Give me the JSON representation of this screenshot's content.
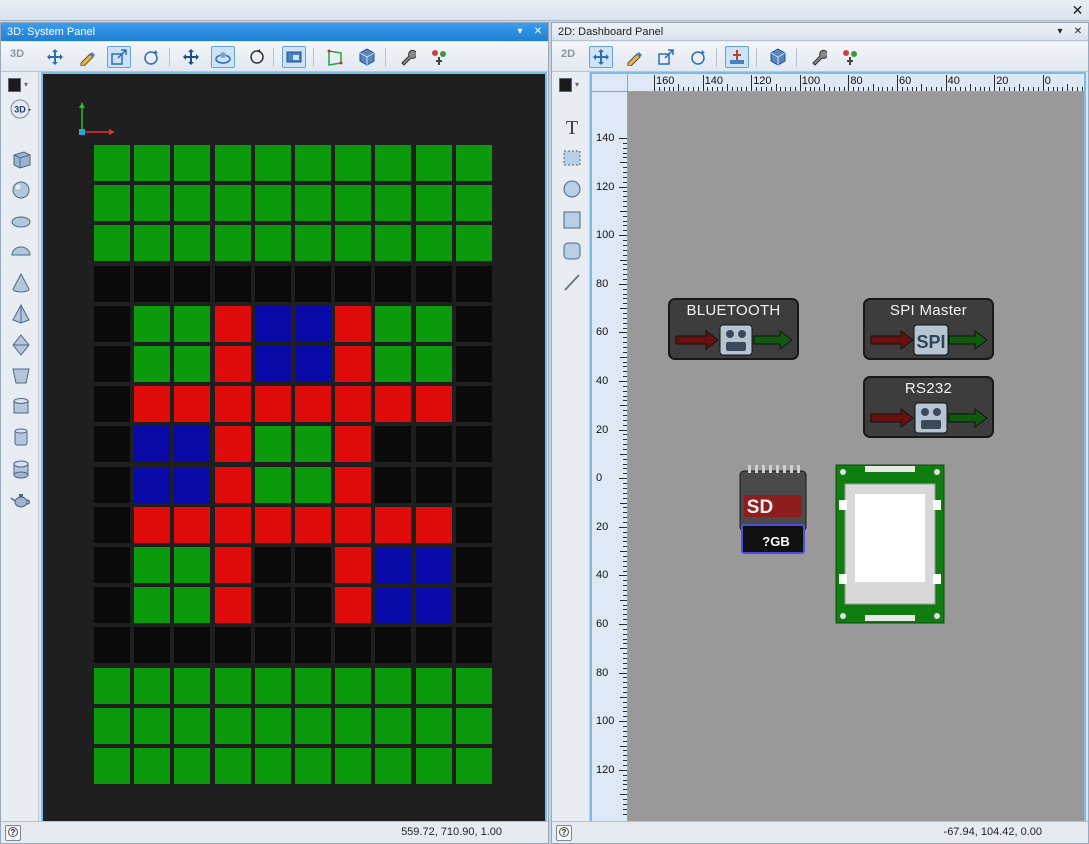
{
  "window": {
    "close_glyph": "✕"
  },
  "panel3d": {
    "title": "3D: System Panel",
    "mode_label": "3D",
    "dropdown_glyph": "▾",
    "close_glyph": "✕",
    "mode_button_label": "3D",
    "status_coords": "559.72, 710.90, 1.00",
    "toolbar_icons": [
      "move-icon",
      "pencil-icon",
      "scale-icon",
      "rotate-icon",
      "pan-icon",
      "orbit-icon",
      "rotate-view-icon",
      "view-2d-icon",
      "perspective-icon",
      "cube-view-icon",
      "wrench-icon",
      "components-icon"
    ],
    "active_tools": [
      "scale-icon",
      "orbit-icon",
      "view-2d-icon"
    ],
    "side_shapes": [
      "box-icon",
      "sphere-icon",
      "ellipsoid-icon",
      "hemisphere-icon",
      "cone-icon",
      "pyramid-icon",
      "octahedron-icon",
      "prism-icon",
      "cylinder-icon",
      "tube-icon",
      "drum-icon",
      "teapot-icon"
    ],
    "grid_colors": {
      "G": "#0b9a0b",
      "R": "#e00c0c",
      "B": "#0a0aa8",
      "K": "#0a0a0a"
    },
    "grid_rows": [
      "GGGGGGGGGG",
      "GGGGGGGGGG",
      "GGGGGGGGGG",
      "KKKKKKKKKK",
      "KGGRBBRGGK",
      "KGGRBBRGGK",
      "KRRRRRRRRK",
      "KBBRGGRKKK",
      "KBBRGGRKKK",
      "KRRRRRRRRK",
      "KGGRKKRBBK",
      "KGGRKKRBBK",
      "KKKKKKKKKK",
      "GGGGGGGGGG",
      "GGGGGGGGGG",
      "GGGGGGGGGG"
    ]
  },
  "panel2d": {
    "title": "2D: Dashboard Panel",
    "mode_label": "2D",
    "dropdown_glyph": "▾",
    "close_glyph": "✕",
    "status_coords": "-67.94, 104.42, 0.00",
    "toolbar_icons": [
      "move-icon",
      "pencil-icon",
      "scale-icon",
      "rotate-icon",
      "anchor-icon",
      "cube-view-icon",
      "wrench-icon",
      "components-icon"
    ],
    "active_tools": [
      "move-icon",
      "anchor-icon"
    ],
    "side_tools": [
      "text-icon",
      "selection-rect-icon",
      "circle-icon",
      "rectangle-icon",
      "rounded-rect-icon",
      "line-icon"
    ],
    "text_tool_glyph": "T",
    "hruler_labels": [
      "160",
      "140",
      "120",
      "100",
      "80",
      "60",
      "40",
      "20",
      "0"
    ],
    "vruler_labels": [
      "140",
      "120",
      "100",
      "80",
      "60",
      "40",
      "20",
      "0",
      "20",
      "40",
      "60",
      "80",
      "100",
      "120"
    ],
    "components": {
      "bluetooth": {
        "label": "BLUETOOTH"
      },
      "spi": {
        "label": "SPI  Master",
        "chip_text": "SPI"
      },
      "rs232": {
        "label": "RS232"
      },
      "sdcard": {
        "logo": "SD",
        "capacity": "?GB"
      }
    }
  },
  "help_glyph": "?"
}
